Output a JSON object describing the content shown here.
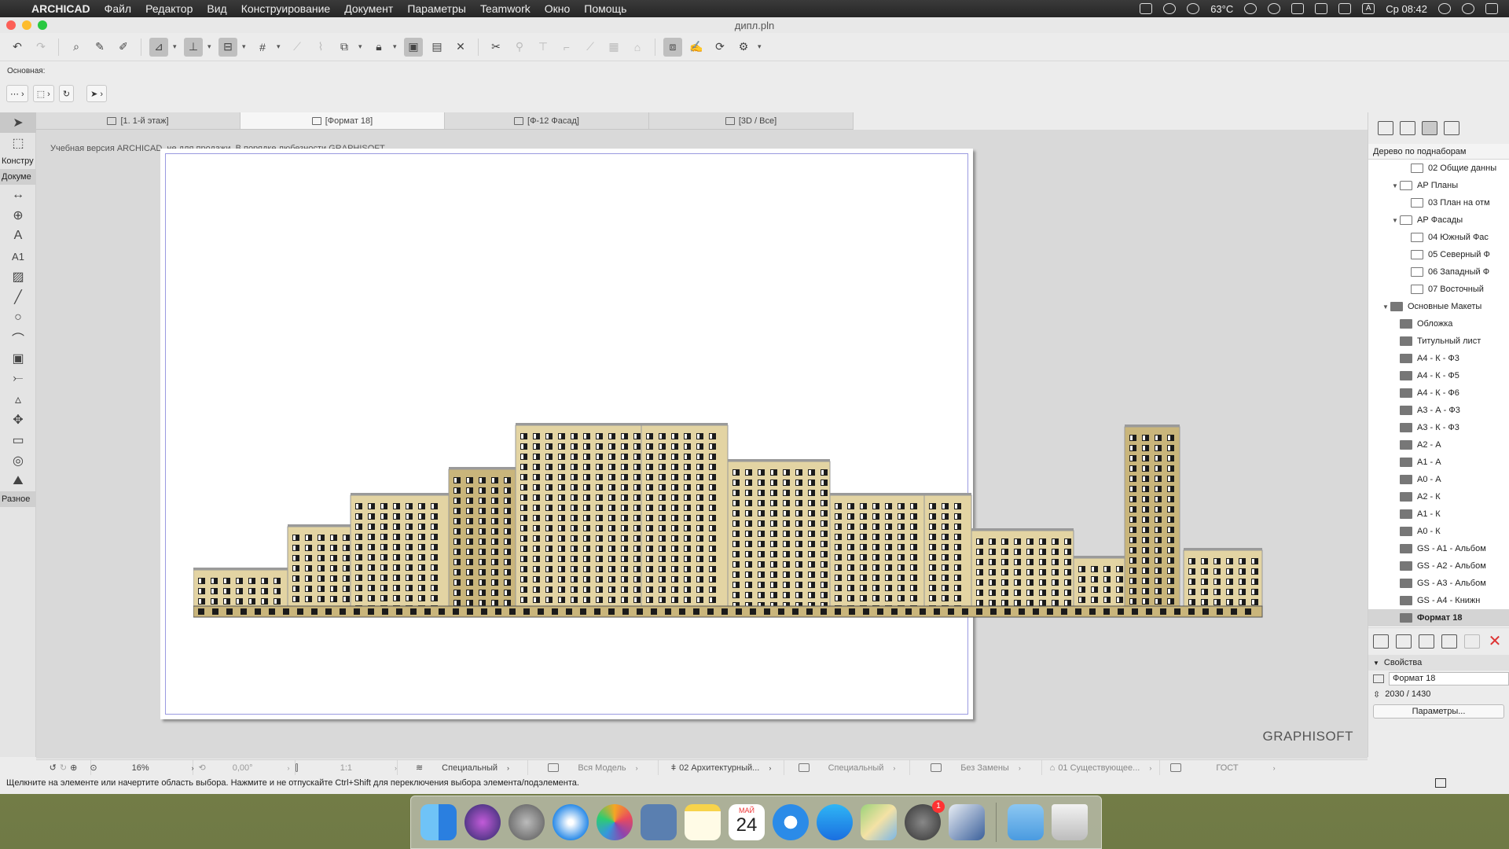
{
  "menubar": {
    "app": "ARCHICAD",
    "items": [
      "Файл",
      "Редактор",
      "Вид",
      "Конструирование",
      "Документ",
      "Параметры",
      "Teamwork",
      "Окно",
      "Помощь"
    ],
    "temperature": "63°C",
    "clock": "Ср 08:42",
    "input_source": "A"
  },
  "window": {
    "title": "дипл.pln"
  },
  "info_box": {
    "label": "Основная:"
  },
  "tabs": [
    {
      "label": "[1. 1-й этаж]",
      "icon": "floor-plan-icon",
      "active": false
    },
    {
      "label": "[Формат 18]",
      "icon": "layout-icon",
      "active": true
    },
    {
      "label": "[Ф-12 Фасад]",
      "icon": "elevation-icon",
      "active": false
    },
    {
      "label": "[3D / Все]",
      "icon": "3d-icon",
      "active": false
    }
  ],
  "toolbox": {
    "categories": {
      "construct": "Констру",
      "document": "Докуме",
      "misc": "Разное"
    },
    "text_tool": "A",
    "label_tool": "A1"
  },
  "canvas": {
    "watermark": "Учебная версия ARCHICAD, не для продажи. В порядке любезности GRAPHISOFT.",
    "brand": "GRAPHISOFT"
  },
  "navigator": {
    "mode": "Дерево по поднаборам",
    "tree": [
      {
        "label": "02 Общие данны",
        "level": 3,
        "type": "layout",
        "expanded": null
      },
      {
        "label": "АР Планы",
        "level": 2,
        "type": "folder",
        "expanded": true
      },
      {
        "label": "03 План на отм",
        "level": 3,
        "type": "layout",
        "expanded": null
      },
      {
        "label": "АР Фасады",
        "level": 2,
        "type": "folder",
        "expanded": true
      },
      {
        "label": "04 Южный Фас",
        "level": 3,
        "type": "layout",
        "expanded": null
      },
      {
        "label": "05 Северный Ф",
        "level": 3,
        "type": "layout",
        "expanded": null
      },
      {
        "label": "06 Западный Ф",
        "level": 3,
        "type": "layout",
        "expanded": null
      },
      {
        "label": "07 Восточный",
        "level": 3,
        "type": "layout",
        "expanded": null
      },
      {
        "label": "Основные Макеты",
        "level": 1,
        "type": "folder-dark",
        "expanded": true
      },
      {
        "label": "Обложка",
        "level": 2,
        "type": "master",
        "expanded": null
      },
      {
        "label": "Титульный лист",
        "level": 2,
        "type": "master",
        "expanded": null
      },
      {
        "label": "А4 - К - Ф3",
        "level": 2,
        "type": "master",
        "expanded": null
      },
      {
        "label": "А4 - К - Ф5",
        "level": 2,
        "type": "master",
        "expanded": null
      },
      {
        "label": "А4 - К - Ф6",
        "level": 2,
        "type": "master",
        "expanded": null
      },
      {
        "label": "А3 - А - Ф3",
        "level": 2,
        "type": "master",
        "expanded": null
      },
      {
        "label": "А3 - К - Ф3",
        "level": 2,
        "type": "master",
        "expanded": null
      },
      {
        "label": "А2 - А",
        "level": 2,
        "type": "master",
        "expanded": null
      },
      {
        "label": "А1 - А",
        "level": 2,
        "type": "master",
        "expanded": null
      },
      {
        "label": "А0 - А",
        "level": 2,
        "type": "master",
        "expanded": null
      },
      {
        "label": "А2 - К",
        "level": 2,
        "type": "master",
        "expanded": null
      },
      {
        "label": "А1 - К",
        "level": 2,
        "type": "master",
        "expanded": null
      },
      {
        "label": "А0 - К",
        "level": 2,
        "type": "master",
        "expanded": null
      },
      {
        "label": "GS - A1 - Альбом",
        "level": 2,
        "type": "master",
        "expanded": null
      },
      {
        "label": "GS - A2 - Альбом",
        "level": 2,
        "type": "master",
        "expanded": null
      },
      {
        "label": "GS - A3 - Альбом",
        "level": 2,
        "type": "master",
        "expanded": null
      },
      {
        "label": "GS - A4 - Книжн",
        "level": 2,
        "type": "master",
        "expanded": null
      },
      {
        "label": "Формат 18",
        "level": 2,
        "type": "master",
        "expanded": null,
        "selected": true
      }
    ],
    "properties": {
      "header": "Свойства",
      "name": "Формат 18",
      "size": "2030 / 1430",
      "params_button": "Параметры..."
    }
  },
  "quickbar": {
    "zoom": "16%",
    "angle": "0,00°",
    "scale": "1:1",
    "layer_combo": "Специальный",
    "model_view": "Вся Модель",
    "pen_set": "02 Архитектурный...",
    "display": "Специальный",
    "override": "Без Замены",
    "renovation": "01 Существующее...",
    "standard": "ГОСТ"
  },
  "statusbar": {
    "text": "Щелкните на элементе или начертите область выбора. Нажмите и не отпускайте Ctrl+Shift для переключения выбора элемента/подэлемента."
  },
  "dock": {
    "calendar_month": "МАЙ",
    "calendar_day": "24",
    "settings_badge": "1",
    "colors": {
      "finder": "#3b8fe8",
      "siri": "#2a2a6a",
      "safari": "#2b8be8"
    }
  },
  "facade_colors": {
    "wall": "#e3d4a3",
    "wall_dark": "#c9b57b",
    "window": "#1b1b1b",
    "trim": "#9a9a9a"
  }
}
